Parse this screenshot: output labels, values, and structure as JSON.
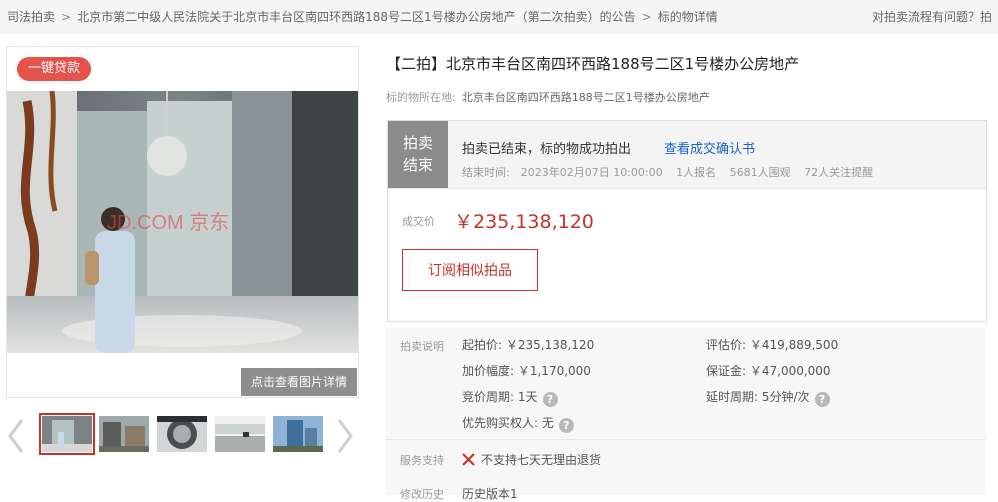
{
  "breadcrumb": {
    "items": [
      "司法拍卖",
      "北京市第二中级人民法院关于北京市丰台区南四环西路188号二区1号楼办公房地产（第二次拍卖）的公告",
      "标的物详情"
    ],
    "separator": ">"
  },
  "help_text": "对拍卖流程有问题？拍",
  "gallery": {
    "loan_badge": "一键贷款",
    "watermark": "JD.COM 京东",
    "view_detail": "点击查看图片详情",
    "thumb_count": 5
  },
  "item": {
    "title": "【二拍】北京市丰台区南四环西路188号二区1号楼办公房地产",
    "location_label": "标的物所在地:",
    "location_value": "北京丰台区南四环西路188号二区1号楼办公房地产"
  },
  "status": {
    "tag_line1": "拍卖",
    "tag_line2": "结束",
    "text": "拍卖已结束，标的物成功拍出",
    "confirm_link": "查看成交确认书",
    "end_time": "结束时间:　2023年02月07日 10:00:00",
    "signups": "1人报名",
    "watchers": "5681人围观",
    "reminders": "72人关注提醒",
    "price_label": "成交价",
    "price": "￥235,138,120",
    "subscribe_button": "订阅相似拍品"
  },
  "auction_info": {
    "section_label": "拍卖说明",
    "start_price": "起拍价: ￥235,138,120",
    "appraisal": "评估价: ￥419,889,500",
    "increment": "加价幅度: ￥1,170,000",
    "deposit": "保证金: ￥47,000,000",
    "cycle": "竞价周期: 1天",
    "delay": "延时周期: 5分钟/次",
    "priority": "优先购买权人: 无",
    "service_label": "服务支持",
    "service_value": "不支持七天无理由退货",
    "history_label": "修改历史",
    "history_value": "历史版本1"
  },
  "colors": {
    "accent": "#c9322c",
    "link": "#1a62c5",
    "badge": "#e4524a",
    "ended_tag": "#8b8b8b"
  }
}
